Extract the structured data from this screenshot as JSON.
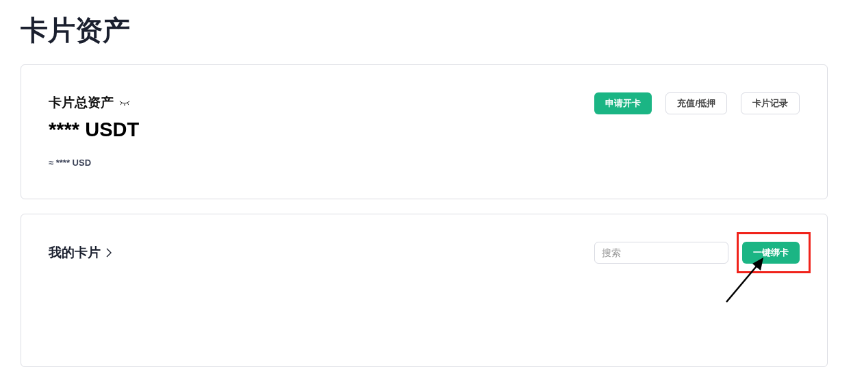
{
  "page": {
    "title": "卡片资产"
  },
  "assets": {
    "label": "卡片总资产",
    "amount": "**** USDT",
    "approx": "≈ **** USD",
    "hidden": true,
    "buttons": [
      {
        "label": "申请开卡",
        "kind": "primary"
      },
      {
        "label": "充值/抵押",
        "kind": "outline"
      },
      {
        "label": "卡片记录",
        "kind": "outline"
      }
    ]
  },
  "my_cards": {
    "title": "我的卡片",
    "search": {
      "placeholder": "搜索"
    },
    "buttons": [
      {
        "label": "一键绑卡",
        "kind": "primary",
        "highlighted": true
      }
    ]
  }
}
